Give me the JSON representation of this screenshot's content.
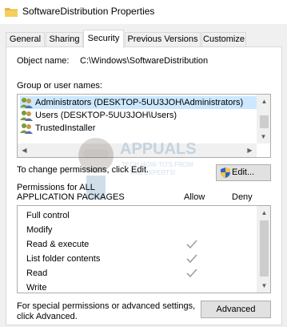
{
  "window": {
    "title": "SoftwareDistribution Properties"
  },
  "tabs": [
    {
      "label": "General"
    },
    {
      "label": "Sharing"
    },
    {
      "label": "Security"
    },
    {
      "label": "Previous Versions"
    },
    {
      "label": "Customize"
    }
  ],
  "object": {
    "label": "Object name:",
    "value": "C:\\Windows\\SoftwareDistribution"
  },
  "groups": {
    "label": "Group or user names:",
    "items": [
      {
        "name": "Administrators (DESKTOP-5UU3JOH\\Administrators)"
      },
      {
        "name": "Users (DESKTOP-5UU3JOH\\Users)"
      },
      {
        "name": "TrustedInstaller"
      }
    ]
  },
  "change": {
    "text": "To change permissions, click Edit.",
    "edit_label": "Edit..."
  },
  "permissions": {
    "header_line1": "Permissions for ALL",
    "header_line2": "APPLICATION PACKAGES",
    "allow_label": "Allow",
    "deny_label": "Deny",
    "rows": [
      {
        "name": "Full control",
        "allow": false
      },
      {
        "name": "Modify",
        "allow": false
      },
      {
        "name": "Read & execute",
        "allow": true
      },
      {
        "name": "List folder contents",
        "allow": true
      },
      {
        "name": "Read",
        "allow": true
      },
      {
        "name": "Write",
        "allow": false
      }
    ]
  },
  "special": {
    "line1": "For special permissions or advanced settings,",
    "line2": "click Advanced.",
    "advanced_label": "Advanced"
  },
  "watermark": {
    "brand": "APPUALS",
    "tagline1": "TECH HOW-TO'S FROM",
    "tagline2": "THE EXPERTS!"
  }
}
